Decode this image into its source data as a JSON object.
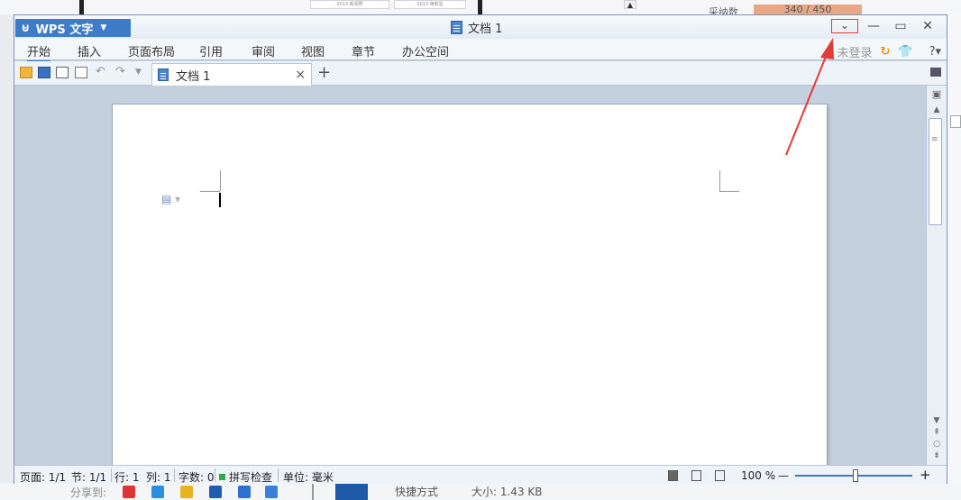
{
  "background": {
    "thumb_labels": [
      "2013 新闻照",
      "2013 用新显"
    ],
    "collect_label": "采纳数",
    "collect_value": "340 / 450",
    "share_label": "分享到:",
    "shortcut_label": "快捷方式",
    "size_label": "大小: 1.43 KB"
  },
  "window": {
    "app_name": "WPS 文字",
    "title": "文档 1",
    "controls": {
      "collapse_ribbon": "⌄",
      "minimize": "—",
      "maximize": "▭",
      "close": "✕"
    }
  },
  "menu_tabs": [
    "开始",
    "插入",
    "页面布局",
    "引用",
    "审阅",
    "视图",
    "章节",
    "办公空间"
  ],
  "account": {
    "login_label": "未登录",
    "help_label": "?"
  },
  "toolbar": {
    "doc_tab_label": "文档 1",
    "close_glyph": "×",
    "new_tab_glyph": "+"
  },
  "statusbar": {
    "page": "页面: 1/1",
    "section": "节: 1/1",
    "row": "行: 1",
    "col": "列: 1",
    "word_count": "字数: 0",
    "spellcheck": "拼写检查",
    "unit": "单位: 毫米",
    "zoom": "100 %",
    "zoom_minus": "—",
    "zoom_plus": "+"
  },
  "zoom_level_percent": 100,
  "colors": {
    "accent": "#3a78c8",
    "app_button": "#3f7cc8",
    "highlight_box": "#e43a3a",
    "arrow": "#e43a3a"
  }
}
